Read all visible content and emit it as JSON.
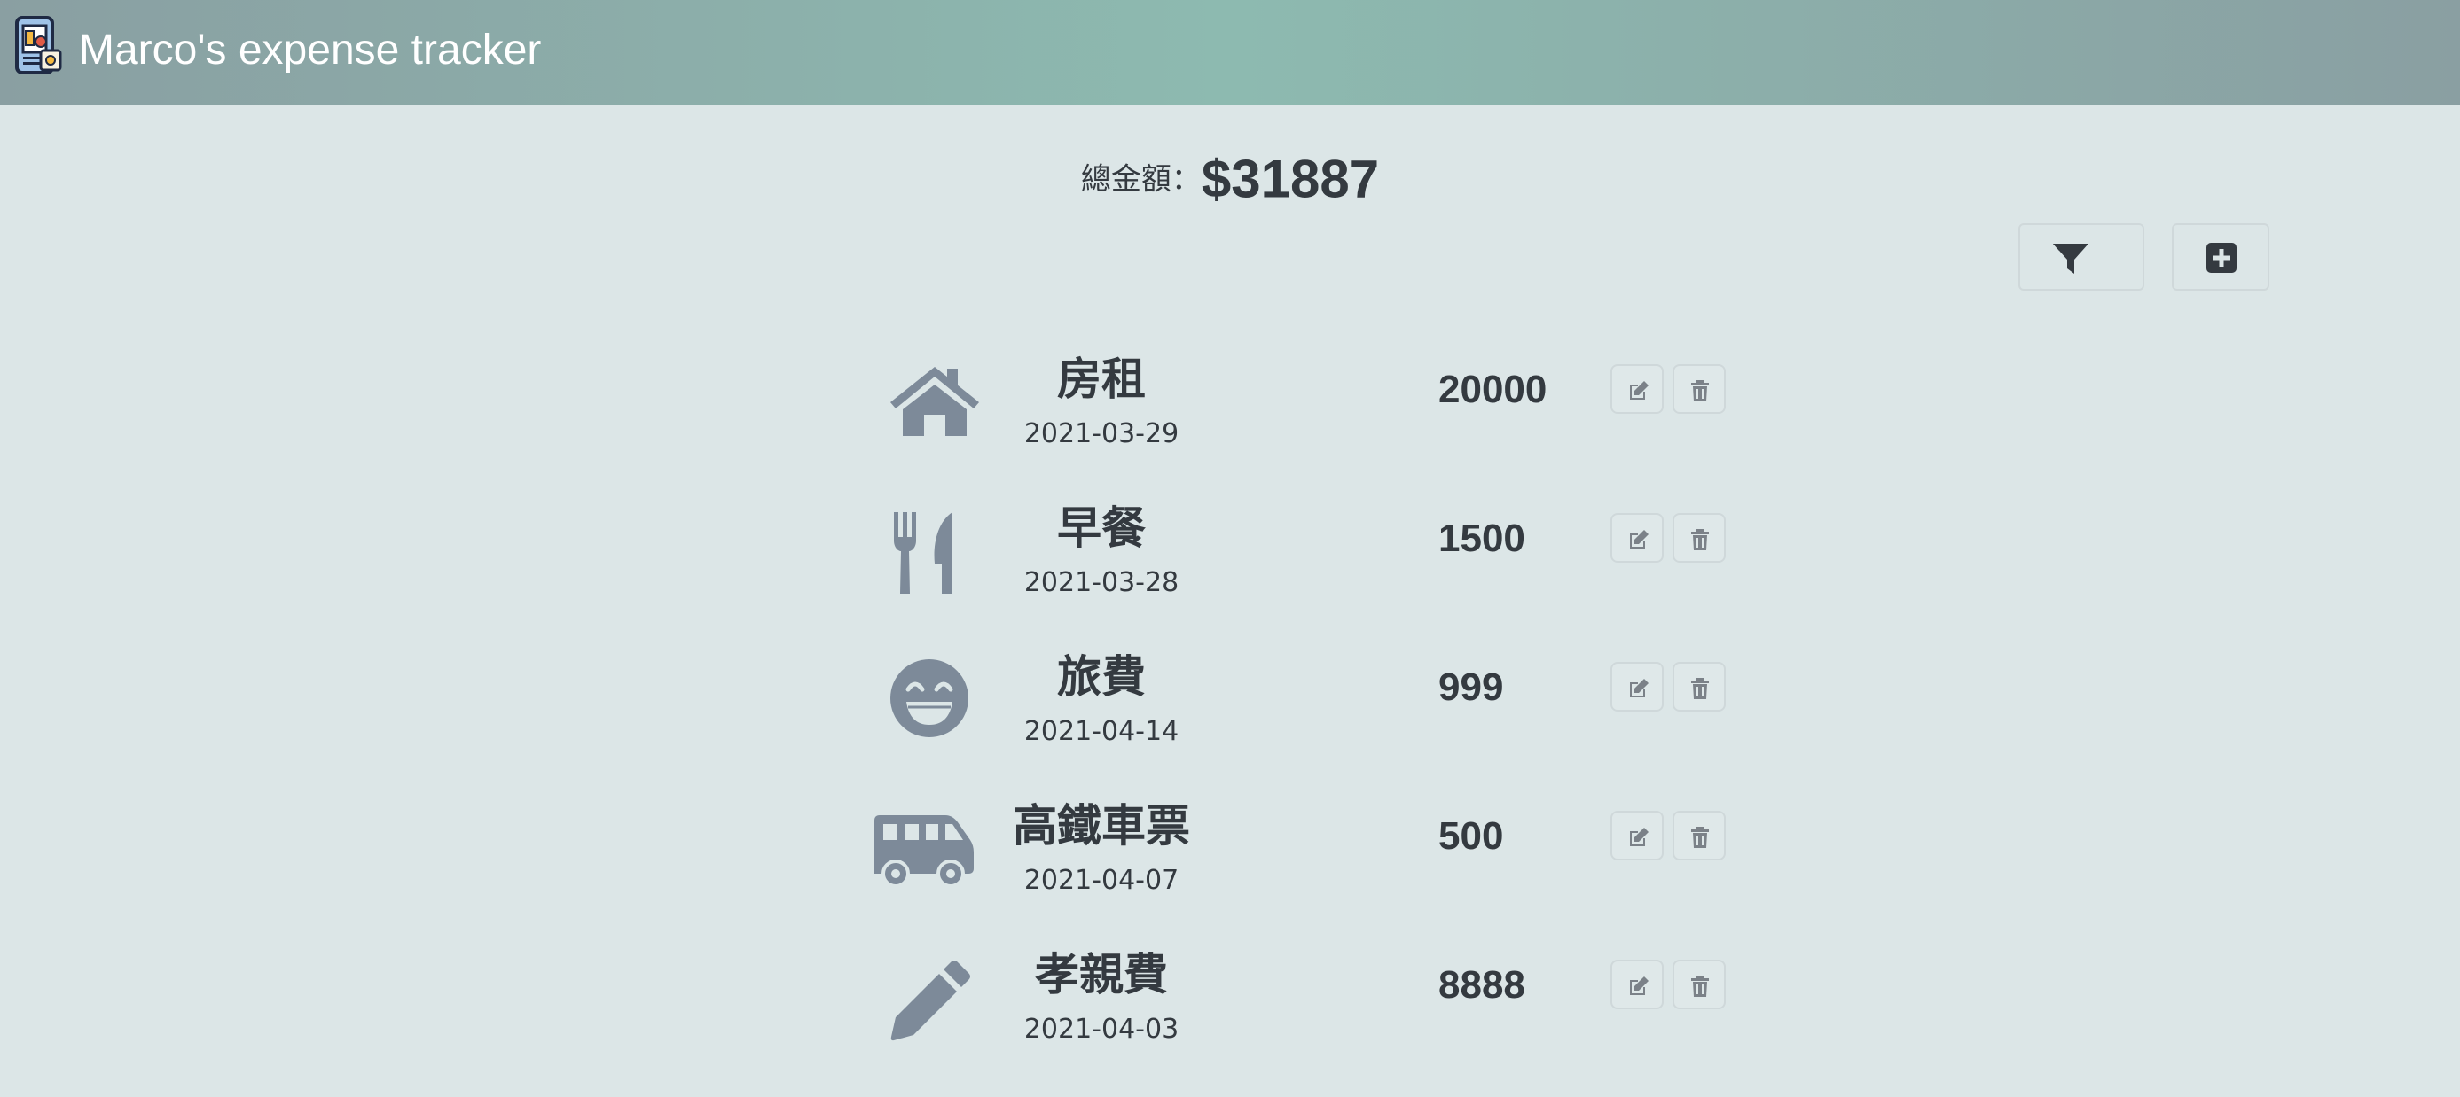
{
  "header": {
    "title": "Marco's expense tracker",
    "logo_icon": "expense-app-logo"
  },
  "summary": {
    "label": "總金額：",
    "amount": "$31887"
  },
  "toolbar": {
    "filter_icon": "filter-icon",
    "add_icon": "plus-square-icon"
  },
  "records": [
    {
      "icon": "home-icon",
      "name": "房租",
      "date": "2021-03-29",
      "amount": "20000"
    },
    {
      "icon": "utensils-icon",
      "name": "早餐",
      "date": "2021-03-28",
      "amount": "1500"
    },
    {
      "icon": "grin-icon",
      "name": "旅費",
      "date": "2021-04-14",
      "amount": "999"
    },
    {
      "icon": "shuttle-van-icon",
      "name": "高鐵車票",
      "date": "2021-04-07",
      "amount": "500"
    },
    {
      "icon": "pen-icon",
      "name": "孝親費",
      "date": "2021-04-03",
      "amount": "8888"
    }
  ],
  "colors": {
    "page_background": "#dce6e7",
    "navbar_gradient_center": "#8dbab0",
    "navbar_gradient_edge": "#8a9fa2",
    "category_icon": "#7d8a99",
    "text_dark": "#343a40"
  }
}
